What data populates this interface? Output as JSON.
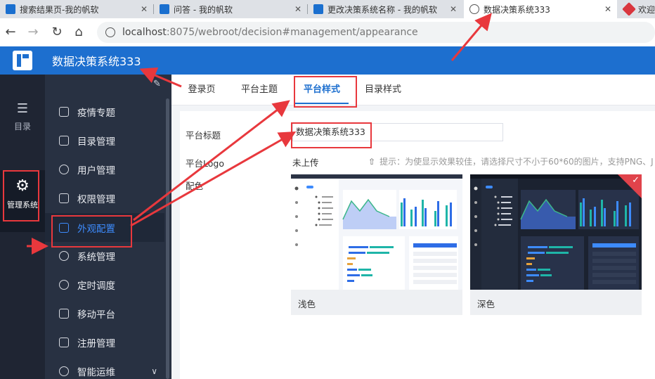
{
  "browser": {
    "tabs": [
      {
        "label": "搜索结果页-我的帆软",
        "close": "✕"
      },
      {
        "label": "问答 - 我的帆软",
        "close": "✕"
      },
      {
        "label": "更改决策系统名称 - 我的帆软",
        "close": "✕"
      },
      {
        "label": "数据决策系统333",
        "close": "✕"
      },
      {
        "label": "欢迎"
      }
    ],
    "url_host": "localhost",
    "url_path": ":8075/webroot/decision#management/appearance",
    "back_icon": "←",
    "forward_icon": "→",
    "reload_icon": "↻",
    "home_icon": "⌂"
  },
  "header": {
    "title": "数据决策系统333",
    "brand_color": "#1d6fcf"
  },
  "rail": {
    "items": [
      {
        "label": "目录",
        "icon": "☰"
      },
      {
        "label": "管理系统",
        "icon": "⚙"
      }
    ]
  },
  "menu": {
    "pin_icon": "✎",
    "items": [
      {
        "label": "疫情专题"
      },
      {
        "label": "目录管理"
      },
      {
        "label": "用户管理"
      },
      {
        "label": "权限管理"
      },
      {
        "label": "外观配置"
      },
      {
        "label": "系统管理"
      },
      {
        "label": "定时调度"
      },
      {
        "label": "移动平台"
      },
      {
        "label": "注册管理"
      },
      {
        "label": "智能运维",
        "chevron": "∨"
      }
    ]
  },
  "main": {
    "tabs": [
      {
        "label": "登录页"
      },
      {
        "label": "平台主题"
      },
      {
        "label": "平台样式"
      },
      {
        "label": "目录样式"
      }
    ],
    "fields": {
      "title_label": "平台标题",
      "title_value": "数据决策系统333",
      "logo_label": "平台Logo",
      "logo_status": "未上传",
      "logo_hint": "提示：为使显示效果较佳，请选择尺寸不小于60*60的图片，支持PNG、J",
      "upload_icon": "⇧",
      "color_label": "配色"
    },
    "themes": [
      {
        "name": "浅色",
        "selected": false
      },
      {
        "name": "深色",
        "selected": true,
        "check": "✓"
      }
    ]
  },
  "annotation_color": "#e8383d"
}
